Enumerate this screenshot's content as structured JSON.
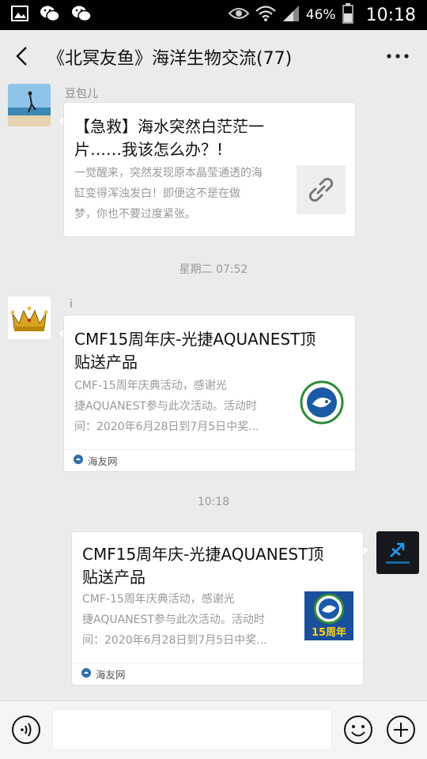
{
  "status_bar": {
    "battery_percent": "46%",
    "time": "10:18",
    "icons": [
      "gallery-icon",
      "wechat-icon",
      "wechat-icon",
      "eye-icon",
      "wifi-icon",
      "signal-icon",
      "battery-icon"
    ]
  },
  "header": {
    "title": "《北冥友鱼》海洋生物交流(77)"
  },
  "messages": [
    {
      "sender": "豆包儿",
      "title": "【急救】海水突然白茫茫一片……我该怎么办？!",
      "desc_lines": [
        "一觉醒来，突然发现原本晶莹通透的海",
        "缸变得浑浊发白！即便这不是在做",
        "梦，你也不要过度紧张。"
      ],
      "thumb_icon": "link-icon"
    },
    {
      "sender": "i",
      "title_lines": [
        "CMF15周年庆-光捷AQUANEST顶",
        "贴送产品"
      ],
      "desc_lines": [
        "CMF-15周年庆典活动，感谢光",
        "捷AQUANEST参与此次活动。活动时",
        "间：2020年6月28日到7月5日中奖..."
      ],
      "source": "海友网"
    },
    {
      "sender": "",
      "title_lines": [
        "CMF15周年庆-光捷AQUANEST顶",
        "贴送产品"
      ],
      "desc_lines": [
        "CMF-15周年庆典活动，感谢光",
        "捷AQUANEST参与此次活动。活动时",
        "间：2020年6月28日到7月5日中奖..."
      ],
      "source": "海友网",
      "thumb_label": "15周年"
    }
  ],
  "timestamps": [
    "星期二 07:52",
    "10:18"
  ],
  "colors": {
    "status_bar": "#000000",
    "background": "#ebebeb",
    "card": "#ffffff",
    "muted_text": "#999999"
  }
}
